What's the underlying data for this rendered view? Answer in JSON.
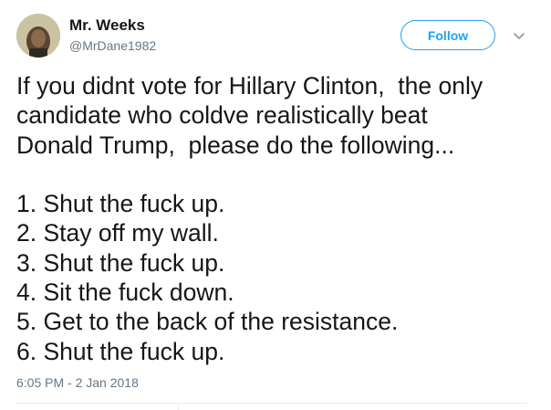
{
  "author": {
    "display_name": "Mr. Weeks",
    "handle": "@MrDane1982",
    "avatar_icon": "profile-photo"
  },
  "actions": {
    "follow_label": "Follow",
    "more_icon": "chevron-down-icon"
  },
  "tweet": {
    "lines": [
      "If you didnt vote for Hillary Clinton,  the only",
      "candidate who coldve realistically beat",
      "Donald Trump,  please do the following...",
      "",
      "1. Shut the fuck up.",
      "2. Stay off my wall.",
      "3. Shut the fuck up.",
      "4. Sit the fuck down.",
      "5. Get to the back of the resistance.",
      "6. Shut the fuck up."
    ],
    "timestamp": "6:05 PM - 2 Jan 2018"
  },
  "colors": {
    "accent": "#1da1f2",
    "text": "#14171a",
    "secondary_text": "#657786",
    "divider": "#e6ecf0"
  }
}
